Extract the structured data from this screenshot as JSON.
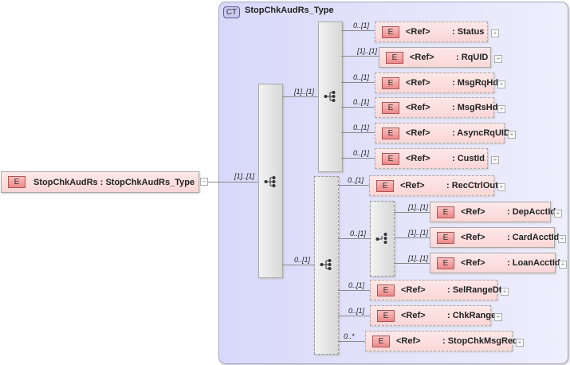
{
  "root": {
    "badge": "E",
    "label": "StopChkAudRs : StopChkAudRs_Type",
    "toggle": "−",
    "cardinality": "[1]..[1]"
  },
  "complex_type": {
    "badge": "CT",
    "title": "StopChkAudRs_Type"
  },
  "main_sequence": {
    "icon": "sequence-icon"
  },
  "seq1": {
    "cardinality": "[1]..[1]",
    "icon": "sequence-icon"
  },
  "seq2": {
    "cardinality": "0..[1]",
    "icon": "sequence-icon"
  },
  "choice": {
    "cardinality": "0..[1]",
    "icon": "choice-icon"
  },
  "elements": [
    {
      "badge": "E",
      "ref": "<Ref>",
      "name": ": Status",
      "cardinality": "0..[1]",
      "expand": "+"
    },
    {
      "badge": "E",
      "ref": "<Ref>",
      "name": ": RqUID",
      "cardinality": "[1]..[1]",
      "expand": "+"
    },
    {
      "badge": "E",
      "ref": "<Ref>",
      "name": ": MsgRqHdr",
      "cardinality": "0..[1]",
      "expand": "+"
    },
    {
      "badge": "E",
      "ref": "<Ref>",
      "name": ": MsgRsHdr",
      "cardinality": "0..[1]",
      "expand": "+"
    },
    {
      "badge": "E",
      "ref": "<Ref>",
      "name": ": AsyncRqUID",
      "cardinality": "0..[1]",
      "expand": "+"
    },
    {
      "badge": "E",
      "ref": "<Ref>",
      "name": ": CustId",
      "cardinality": "0..[1]",
      "expand": "+"
    },
    {
      "badge": "E",
      "ref": "<Ref>",
      "name": ": RecCtrlOut",
      "cardinality": "0..[1]",
      "expand": "+"
    },
    {
      "badge": "E",
      "ref": "<Ref>",
      "name": ": DepAcctId",
      "cardinality": "[1]..[1]",
      "expand": "+"
    },
    {
      "badge": "E",
      "ref": "<Ref>",
      "name": ": CardAcctId",
      "cardinality": "[1]..[1]",
      "expand": "+"
    },
    {
      "badge": "E",
      "ref": "<Ref>",
      "name": ": LoanAcctId",
      "cardinality": "[1]..[1]",
      "expand": "+"
    },
    {
      "badge": "E",
      "ref": "<Ref>",
      "name": ": SelRangeDt",
      "cardinality": "0..[1]",
      "expand": "+"
    },
    {
      "badge": "E",
      "ref": "<Ref>",
      "name": ": ChkRange",
      "cardinality": "0..[1]",
      "expand": "+"
    },
    {
      "badge": "E",
      "ref": "<Ref>",
      "name": ": StopChkMsgRec",
      "cardinality": "0..*",
      "expand": "+"
    }
  ]
}
